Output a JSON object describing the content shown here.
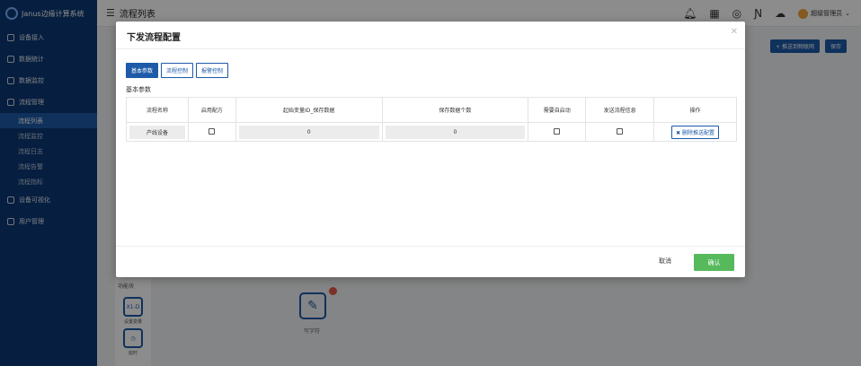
{
  "app": {
    "name": "Janus边缘计算系统"
  },
  "sidebar": {
    "items": [
      {
        "label": "设备接入"
      },
      {
        "label": "数据统计"
      },
      {
        "label": "数据监控"
      },
      {
        "label": "流程管理"
      },
      {
        "label": "设备可视化"
      },
      {
        "label": "用户管理"
      }
    ],
    "submenu": [
      {
        "label": "流程列表",
        "active": true
      },
      {
        "label": "流程监控"
      },
      {
        "label": "流程日志"
      },
      {
        "label": "流程告警"
      },
      {
        "label": "流程指标"
      }
    ]
  },
  "header": {
    "title": "流程列表",
    "user": "超级管理员"
  },
  "bg_toolbar": {
    "button1": "+ 推送到物联网",
    "button2": "保存"
  },
  "bg_canvas": {
    "panel_title": "功能块",
    "tile1_icon": "X1-D",
    "tile1_label": "设置变量",
    "tile2_label": "延时",
    "node_label": "写字符"
  },
  "modal": {
    "title": "下发流程配置",
    "tabs": [
      {
        "label": "基本参数",
        "active": true
      },
      {
        "label": "流程控制"
      },
      {
        "label": "报警控制"
      }
    ],
    "section_label": "基本参数",
    "table": {
      "headers": [
        "流程名称",
        "启用配方",
        "起始变量ID_保存数据",
        "保存数据个数",
        "需要自启动",
        "发送流程信息",
        "操作"
      ],
      "rows": [
        {
          "name": "产线设备",
          "start_id": "0",
          "count": "0",
          "action": "✖ 删除推送配置"
        }
      ]
    },
    "cancel": "取消",
    "ok": "确认"
  }
}
